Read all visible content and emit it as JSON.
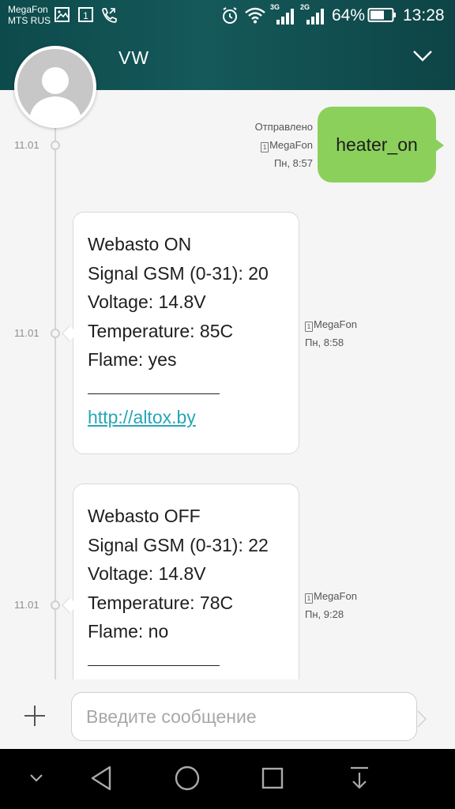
{
  "status_bar": {
    "carrier_1": "MegaFon",
    "carrier_2": "MTS RUS",
    "network_1": "3G",
    "network_2": "2G",
    "battery": "64%",
    "time": "13:28"
  },
  "header": {
    "contact_name": "VW"
  },
  "messages": [
    {
      "direction": "outgoing",
      "date": "11.01",
      "status": "Отправлено",
      "sim": "MegaFon",
      "sim_slot": "1",
      "time": "Пн, 8:57",
      "text": "heater_on"
    },
    {
      "direction": "incoming",
      "date": "11.01",
      "sim": "MegaFon",
      "sim_slot": "1",
      "time": "Пн, 8:58",
      "lines": [
        "Webasto ON",
        "Signal GSM (0-31): 20",
        "Voltage: 14.8V",
        "Temperature: 85C",
        "Flame: yes"
      ],
      "link": "http://altox.by"
    },
    {
      "direction": "incoming",
      "date": "11.01",
      "sim": "MegaFon",
      "sim_slot": "1",
      "time": "Пн, 9:28",
      "lines": [
        "Webasto OFF",
        "Signal GSM (0-31): 22",
        "Voltage: 14.8V",
        "Temperature: 78C",
        "Flame: no"
      ]
    }
  ],
  "compose": {
    "placeholder": "Введите сообщение"
  },
  "colors": {
    "header": "#15595a",
    "outgoing_bubble": "#8cd05c",
    "link": "#26a6b8"
  }
}
